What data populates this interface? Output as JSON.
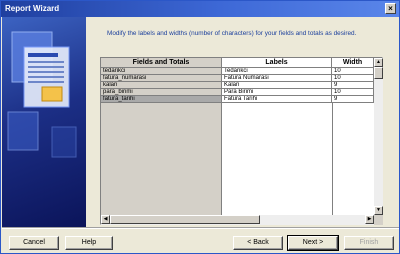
{
  "window": {
    "title": "Report Wizard",
    "close_label": "×"
  },
  "content": {
    "instruction": "Modify the labels and widths (number of characters) for your fields and totals as desired."
  },
  "grid": {
    "headers": [
      "Fields and Totals",
      "Labels",
      "Width"
    ],
    "rows": [
      {
        "field": "tedarikci",
        "label": "Tedarikci",
        "width": "10"
      },
      {
        "field": "fatura_numarasi",
        "label": "Fatura Numarasi",
        "width": "10"
      },
      {
        "field": "kalan",
        "label": "Kalan",
        "width": "9"
      },
      {
        "field": "para_birimi",
        "label": "Para Birimi",
        "width": "10"
      },
      {
        "field": "fatura_tarihi",
        "label": "Fatura Tarihi",
        "width": "9"
      }
    ],
    "selected_row": 4
  },
  "buttons": {
    "cancel": "Cancel",
    "help": "Help",
    "back": "< Back",
    "next": "Next >",
    "finish": "Finish"
  }
}
